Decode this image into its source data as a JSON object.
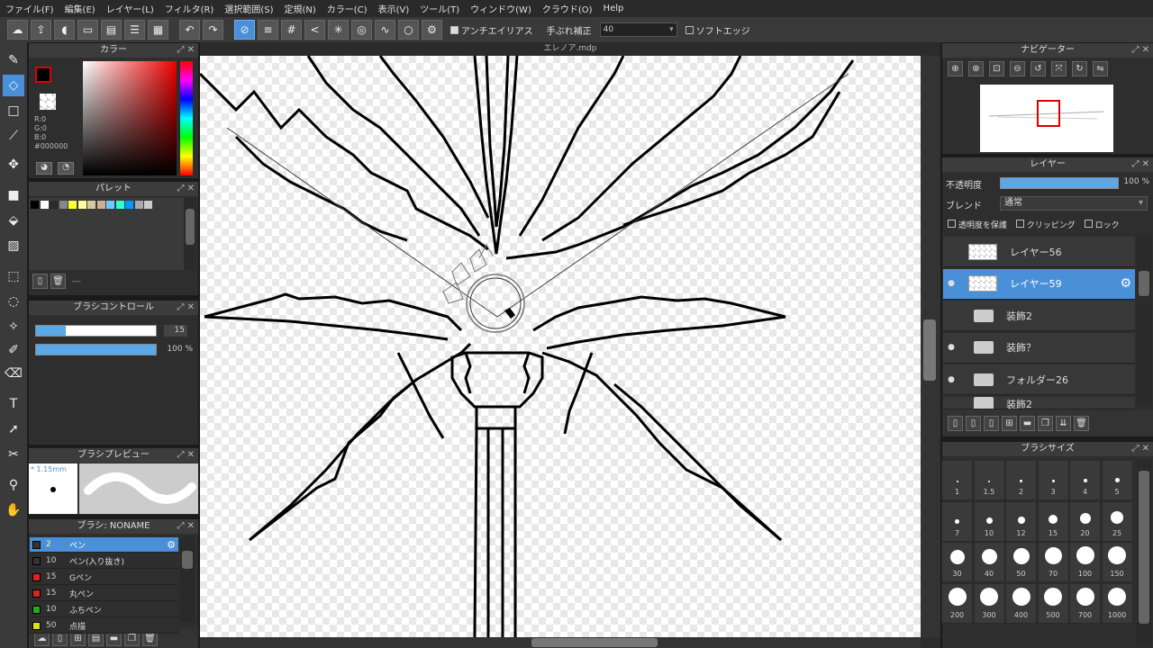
{
  "menu": [
    "ファイル(F)",
    "編集(E)",
    "レイヤー(L)",
    "フィルタ(R)",
    "選択範囲(S)",
    "定規(N)",
    "カラー(C)",
    "表示(V)",
    "ツール(T)",
    "ウィンドウ(W)",
    "クラウド(O)",
    "Help"
  ],
  "toolbar": {
    "antialias_label": "アンチエイリアス",
    "stabilizer_label": "手ぶれ補正",
    "stabilizer_value": "40",
    "soft_edge_label": "ソフトエッジ"
  },
  "document": {
    "title": "エレノア.mdp"
  },
  "color_panel": {
    "title": "カラー",
    "r": "R:0",
    "g": "G:0",
    "b": "B:0",
    "hex": "#000000",
    "foreground": "#000000"
  },
  "palette_panel": {
    "title": "パレット",
    "swatches": [
      "#000000",
      "#ffffff",
      "#2b2b2b",
      "#888888",
      "#ffff33",
      "#ffff99",
      "#d8c8a0",
      "#d0b090",
      "#66ccff",
      "#33ffcc",
      "#0099ff",
      "#aaaaaa",
      "#cccccc"
    ],
    "footer_text": "---"
  },
  "brush_control": {
    "title": "ブラシコントロール",
    "size_value": "15",
    "size_fill": 0.25,
    "opacity_value": "100 %",
    "opacity_fill": 1.0
  },
  "brush_preview": {
    "title": "ブラシプレビュー",
    "size_text": "* 1.15mm"
  },
  "brush_list": {
    "title": "ブラシ: NONAME",
    "items": [
      {
        "size": "2",
        "name": "ペン",
        "color": "#333333",
        "selected": true
      },
      {
        "size": "10",
        "name": "ペン(入り抜き)",
        "color": "#333333"
      },
      {
        "size": "15",
        "name": "Gペン",
        "color": "#dd2222"
      },
      {
        "size": "15",
        "name": "丸ペン",
        "color": "#dd2222"
      },
      {
        "size": "10",
        "name": "ふちペン",
        "color": "#22aa22"
      },
      {
        "size": "50",
        "name": "点描",
        "color": "#dddd22"
      }
    ]
  },
  "navigator": {
    "title": "ナビゲーター"
  },
  "layer_panel": {
    "title": "レイヤー",
    "opacity_label": "不透明度",
    "opacity_value": "100 %",
    "opacity_fill": 1.0,
    "blend_label": "ブレンド",
    "blend_value": "通常",
    "protect_alpha_label": "透明度を保護",
    "clipping_label": "クリッピング",
    "lock_label": "ロック",
    "layers": [
      {
        "name": "レイヤー56",
        "type": "layer",
        "visible": false,
        "selected": false
      },
      {
        "name": "レイヤー59",
        "type": "layer",
        "visible": true,
        "selected": true
      },
      {
        "name": "装飾2",
        "type": "folder",
        "visible": false,
        "selected": false
      },
      {
        "name": "装飾？",
        "type": "folder",
        "visible": true,
        "selected": false
      },
      {
        "name": "フォルダー26",
        "type": "folder",
        "visible": true,
        "selected": false
      },
      {
        "name": "装飾2",
        "type": "folder",
        "visible": false,
        "selected": false
      }
    ]
  },
  "brush_size_panel": {
    "title": "ブラシサイズ",
    "sizes": [
      "1",
      "1.5",
      "2",
      "3",
      "4",
      "5",
      "7",
      "10",
      "12",
      "15",
      "20",
      "25",
      "30",
      "40",
      "50",
      "70",
      "100",
      "150",
      "200",
      "300",
      "400",
      "500",
      "700",
      "1000"
    ]
  }
}
